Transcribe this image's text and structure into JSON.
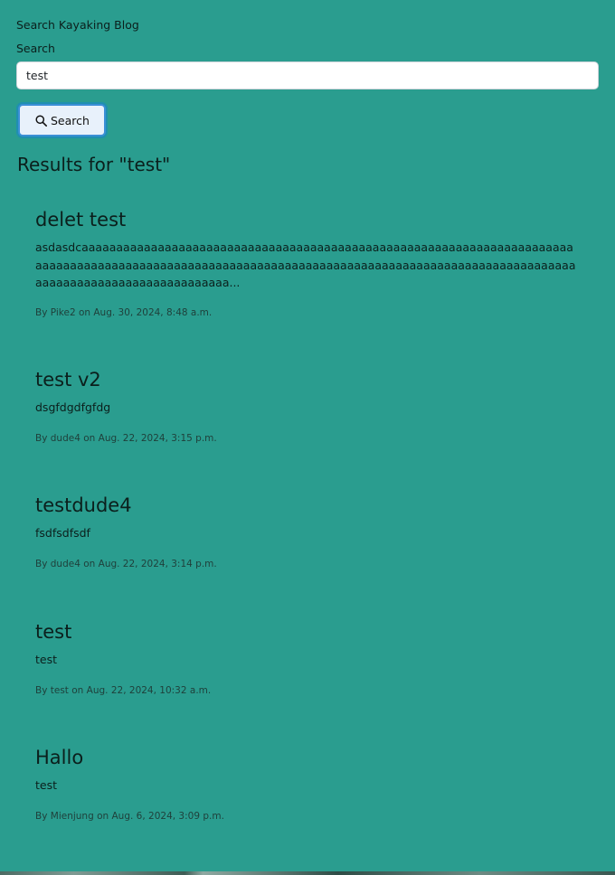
{
  "search_form": {
    "title": "Search Kayaking Blog",
    "label": "Search",
    "input_value": "test",
    "button_label": "Search"
  },
  "results": {
    "heading": "Results for \"test\"",
    "posts": [
      {
        "title": "delet test",
        "excerpt": "asdasdcaaaaaaaaaaaaaaaaaaaaaaaaaaaaaaaaaaaaaaaaaaaaaaaaaaaaaaaaaaaaaaaaaaaaaaaaaaaaaaaaaaaaaaaaaaaaaaaaaaaaaaaaaaaaaaaaaaaaaaaaaaaaaaaaaaaaaaaaaaaaaaaaaaaaaaaaaaaaaaaaaaaaaaaaaaaaaaaaa...",
        "meta": "By Pike2 on Aug. 30, 2024, 8:48 a.m."
      },
      {
        "title": "test v2",
        "excerpt": "dsgfdgdfgfdg",
        "meta": "By dude4 on Aug. 22, 2024, 3:15 p.m."
      },
      {
        "title": "testdude4",
        "excerpt": "fsdfsdfsdf",
        "meta": "By dude4 on Aug. 22, 2024, 3:14 p.m."
      },
      {
        "title": "test",
        "excerpt": "test",
        "meta": "By test on Aug. 22, 2024, 10:32 a.m."
      },
      {
        "title": "Hallo",
        "excerpt": "test",
        "meta": "By Mienjung on Aug. 6, 2024, 3:09 p.m."
      }
    ]
  },
  "icons": {
    "search_button_icon": "search-icon"
  },
  "colors": {
    "background": "#2a9d8f",
    "button_background": "#e8f1fb",
    "button_border": "#3b8fd6"
  }
}
